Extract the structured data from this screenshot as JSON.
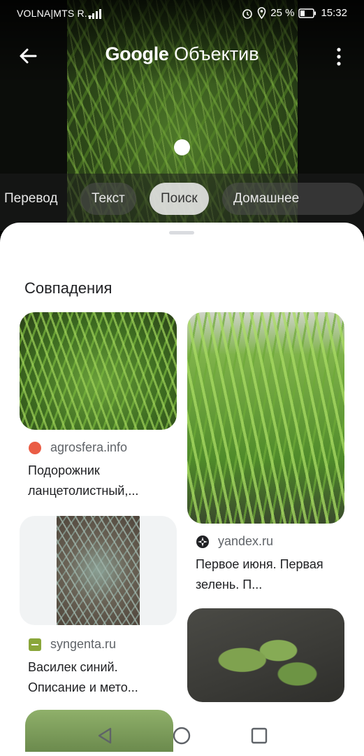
{
  "status_bar": {
    "carrier": "VOLNA|MTS R...",
    "battery": "25 %",
    "time": "15:32"
  },
  "header": {
    "brand": "Google",
    "product": "Объектив"
  },
  "modes": [
    {
      "label": "Перевод"
    },
    {
      "label": "Текст"
    },
    {
      "label": "Поиск"
    },
    {
      "label": "Домашнее задание"
    }
  ],
  "active_mode": "Поиск",
  "results": {
    "heading": "Совпадения",
    "items": [
      {
        "source": "agrosfera.info",
        "favicon_color": "#ea5d45",
        "title": "Подорожник ланцетолистный,..."
      },
      {
        "source": "yandex.ru",
        "favicon_color": "#202124",
        "title": "Первое июня. Первая зелень. П..."
      },
      {
        "source": "syngenta.ru",
        "favicon_color": "#8aa63a",
        "title": "Василек синий. Описание и мето..."
      }
    ]
  },
  "icons": {
    "back": "arrow-left-icon",
    "more": "more-vert-icon",
    "nav_back": "triangle-back-icon",
    "nav_home": "circle-home-icon",
    "nav_recent": "square-recent-icon"
  }
}
